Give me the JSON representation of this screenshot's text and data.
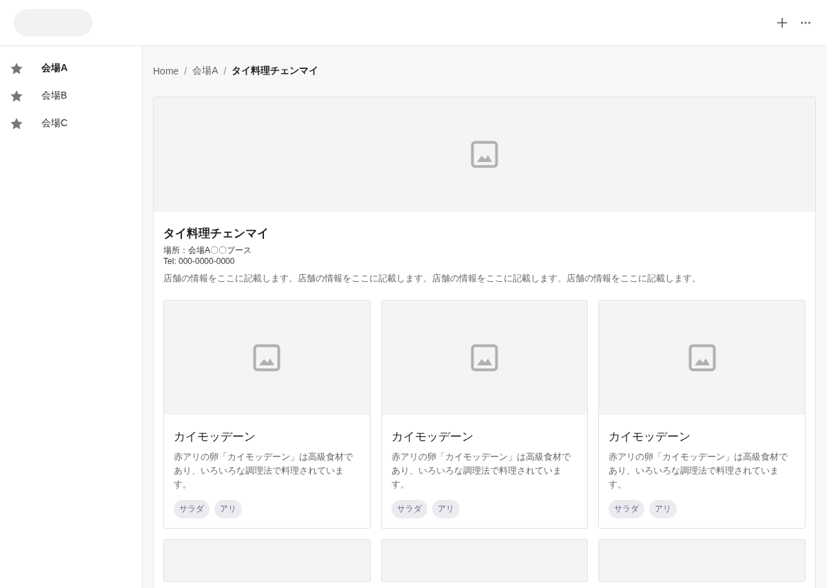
{
  "header": {
    "actions": [
      {
        "kind": "add"
      },
      {
        "kind": "more"
      }
    ]
  },
  "sidebar": {
    "items": [
      {
        "label": "会場A",
        "selected": true
      },
      {
        "label": "会場B",
        "selected": false
      },
      {
        "label": "会場C",
        "selected": false
      }
    ]
  },
  "breadcrumb_separator": "/",
  "breadcrumb": [
    {
      "label": "Home",
      "current": false
    },
    {
      "label": "会場A",
      "current": false
    },
    {
      "label": "タイ料理チェンマイ",
      "current": true
    }
  ],
  "shop": {
    "name": "タイ料理チェンマイ",
    "location": "場所：会場A〇〇ブース",
    "tel": "Tel: 000-0000-0000",
    "description": "店舗の情報をここに記載します。店舗の情報をここに記載します。店舗の情報をここに記載します。店舗の情報をここに記載します。"
  },
  "cards": [
    {
      "kind": "full",
      "title": "カイモッデーン",
      "text": "赤アリの卵「カイモッデーン」は高級食材であり、いろいろな調理法で料理されています。",
      "tags": [
        "サラダ",
        "アリ"
      ]
    },
    {
      "kind": "full",
      "title": "カイモッデーン",
      "text": "赤アリの卵「カイモッデーン」は高級食材であり、いろいろな調理法で料理されています。",
      "tags": [
        "サラダ",
        "アリ"
      ]
    },
    {
      "kind": "full",
      "title": "カイモッデーン",
      "text": "赤アリの卵「カイモッデーン」は高級食材であり、いろいろな調理法で料理されています。",
      "tags": [
        "サラダ",
        "アリ"
      ]
    },
    {
      "kind": "cut"
    },
    {
      "kind": "cut"
    },
    {
      "kind": "cut"
    }
  ]
}
